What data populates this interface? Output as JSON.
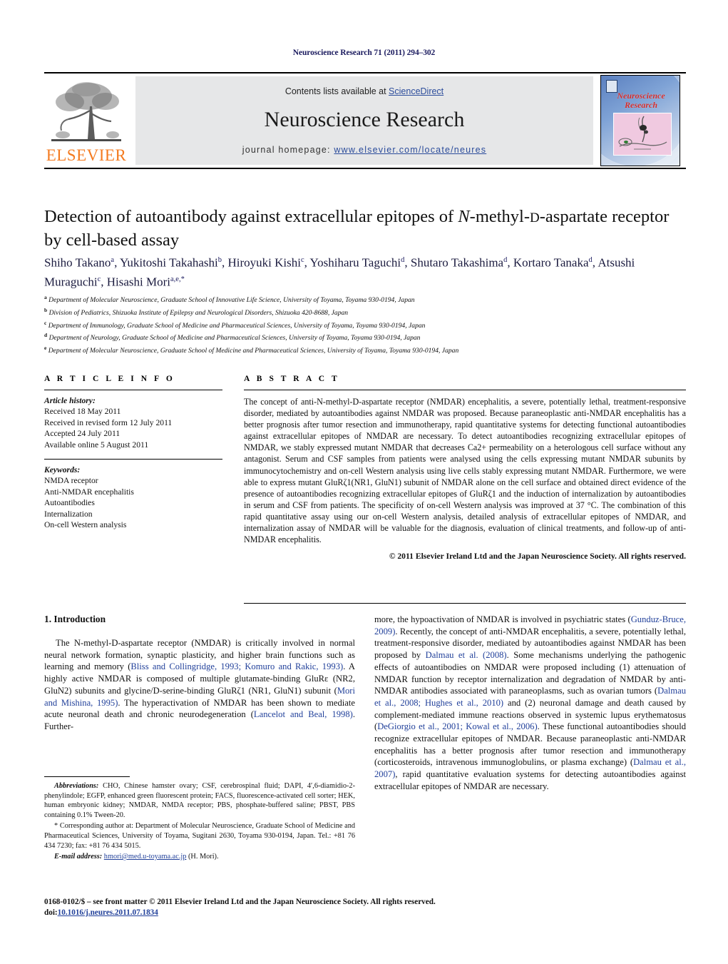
{
  "running_head": "Neuroscience Research 71 (2011) 294–302",
  "masthead": {
    "contents_prefix": "Contents lists available at ",
    "sciencedirect": "ScienceDirect",
    "journal_title": "Neuroscience Research",
    "homepage_prefix": "journal homepage: ",
    "homepage_url": "www.elsevier.com/locate/neures",
    "publisher": "ELSEVIER",
    "cover_title_line1": "Neuroscience",
    "cover_title_line2": "Research",
    "link_color": "#2b4c9b",
    "publisher_color": "#F47B20",
    "panel_color": "#e6e7e8"
  },
  "article": {
    "title_line1_a": "Detection of autoantibody against extracellular epitopes of ",
    "title_line1_italic": "N",
    "title_line1_b": "-methyl-",
    "title_line1_smallcap": "D",
    "title_line1_c": "-aspartate",
    "title_line2": "receptor by cell-based assay",
    "authors_line1": "Shiho Takano",
    "authors": [
      {
        "name": "Shiho Takano",
        "sup": "a",
        "sep": ", "
      },
      {
        "name": "Yukitoshi Takahashi",
        "sup": "b",
        "sep": ", "
      },
      {
        "name": "Hiroyuki Kishi",
        "sup": "c",
        "sep": ", "
      },
      {
        "name": "Yoshiharu Taguchi",
        "sup": "d",
        "sep": ", "
      },
      {
        "name": "Shutaro Takashima",
        "sup": "d",
        "sep": ","
      },
      {
        "name": "Kortaro Tanaka",
        "sup": "d",
        "sep": ", "
      },
      {
        "name": "Atsushi Muraguchi",
        "sup": "c",
        "sep": ", "
      },
      {
        "name": "Hisashi Mori",
        "sup": "a,e,*",
        "sep": ""
      }
    ],
    "affiliations": [
      {
        "marker": "a",
        "text": "Department of Molecular Neuroscience, Graduate School of Innovative Life Science, University of Toyama, Toyama 930-0194, Japan"
      },
      {
        "marker": "b",
        "text": "Division of Pediatrics, Shizuoka Institute of Epilepsy and Neurological Disorders, Shizuoka 420-8688, Japan"
      },
      {
        "marker": "c",
        "text": "Department of Immunology, Graduate School of Medicine and Pharmaceutical Sciences, University of Toyama, Toyama 930-0194, Japan"
      },
      {
        "marker": "d",
        "text": "Department of Neurology, Graduate School of Medicine and Pharmaceutical Sciences, University of Toyama, Toyama 930-0194, Japan"
      },
      {
        "marker": "e",
        "text": "Department of Molecular Neuroscience, Graduate School of Medicine and Pharmaceutical Sciences, University of Toyama, Toyama 930-0194, Japan"
      }
    ]
  },
  "article_info": {
    "heading": "A R T I C L E    I N F O",
    "history_label": "Article history:",
    "history": [
      "Received 18 May 2011",
      "Received in revised form 12 July 2011",
      "Accepted 24 July 2011",
      "Available online 5 August 2011"
    ],
    "keywords_label": "Keywords:",
    "keywords": [
      "NMDA receptor",
      "Anti-NMDAR encephalitis",
      "Autoantibodies",
      "Internalization",
      "On-cell Western analysis"
    ]
  },
  "abstract": {
    "heading": "A B S T R A C T",
    "text": "The concept of anti-N-methyl-D-aspartate receptor (NMDAR) encephalitis, a severe, potentially lethal, treatment-responsive disorder, mediated by autoantibodies against NMDAR was proposed. Because paraneoplastic anti-NMDAR encephalitis has a better prognosis after tumor resection and immunotherapy, rapid quantitative systems for detecting functional autoantibodies against extracellular epitopes of NMDAR are necessary. To detect autoantibodies recognizing extracellular epitopes of NMDAR, we stably expressed mutant NMDAR that decreases Ca2+ permeability on a heterologous cell surface without any antagonist. Serum and CSF samples from patients were analysed using the cells expressing mutant NMDAR subunits by immunocytochemistry and on-cell Western analysis using live cells stably expressing mutant NMDAR. Furthermore, we were able to express mutant GluRζ1(NR1, GluN1) subunit of NMDAR alone on the cell surface and obtained direct evidence of the presence of autoantibodies recognizing extracellular epitopes of GluRζ1 and the induction of internalization by autoantibodies in serum and CSF from patients. The specificity of on-cell Western analysis was improved at 37 °C. The combination of this rapid quantitative assay using our on-cell Western analysis, detailed analysis of extracellular epitopes of NMDAR, and internalization assay of NMDAR will be valuable for the diagnosis, evaluation of clinical treatments, and follow-up of anti-NMDAR encephalitis.",
    "copyright": "© 2011 Elsevier Ireland Ltd and the Japan Neuroscience Society. All rights reserved."
  },
  "introduction": {
    "section_title": "1.  Introduction",
    "left_paragraph": "The N-methyl-D-aspartate receptor (NMDAR) is critically involved in normal neural network formation, synaptic plasticity, and higher brain functions such as learning and memory (Bliss and Collingridge, 1993; Komuro and Rakic, 1993). A highly active NMDAR is composed of multiple glutamate-binding GluRε (NR2, GluN2) subunits and glycine/D-serine-binding GluRζ1 (NR1, GluN1) subunit (Mori and Mishina, 1995). The hyperactivation of NMDAR has been shown to mediate acute neuronal death and chronic neurodegeneration (Lancelot and Beal, 1998). Further-",
    "right_paragraph": "more, the hypoactivation of NMDAR is involved in psychiatric states (Gunduz-Bruce, 2009). Recently, the concept of anti-NMDAR encephalitis, a severe, potentially lethal, treatment-responsive disorder, mediated by autoantibodies against NMDAR has been proposed by Dalmau et al. (2008). Some mechanisms underlying the pathogenic effects of autoantibodies on NMDAR were proposed including (1) attenuation of NMDAR function by receptor internalization and degradation of NMDAR by anti-NMDAR antibodies associated with paraneoplasms, such as ovarian tumors (Dalmau et al., 2008; Hughes et al., 2010) and (2) neuronal damage and death caused by complement-mediated immune reactions observed in systemic lupus erythematosus (DeGiorgio et al., 2001; Kowal et al., 2006). These functional autoantibodies should recognize extracellular epitopes of NMDAR. Because paraneoplastic anti-NMDAR encephalitis has a better prognosis after tumor resection and immunotherapy (corticosteroids, intravenous immunoglobulins, or plasma exchange) (Dalmau et al., 2007), rapid quantitative evaluation systems for detecting autoantibodies against extracellular epitopes of NMDAR are necessary."
  },
  "footnote": {
    "abbrev_label": "Abbreviations:",
    "abbrev_text": "CHO, Chinese hamster ovary; CSF, cerebrospinal fluid; DAPI, 4′,6-diamidio-2-phenylindole; EGFP, enhanced green fluorescent protein; FACS, fluorescence-activated cell sorter; HEK, human embryonic kidney; NMDAR, NMDA receptor; PBS, phosphate-buffered saline; PBST, PBS containing 0.1% Tween-20.",
    "corresponding_marker": "*",
    "corresponding_text": "Corresponding author at: Department of Molecular Neuroscience, Graduate School of Medicine and Pharmaceutical Sciences, University of Toyama, Sugitani 2630, Toyama 930-0194, Japan. Tel.: +81 76 434 7230; fax: +81 76 434 5015.",
    "email_label": "E-mail address:",
    "email": "hmori@med.u-toyama.ac.jp",
    "email_suffix": "(H. Mori)."
  },
  "page_footer": {
    "line1": "0168-0102/$ – see front matter © 2011 Elsevier Ireland Ltd and the Japan Neuroscience Society. All rights reserved.",
    "doi_label": "doi:",
    "doi": "10.1016/j.neures.2011.07.1834"
  }
}
